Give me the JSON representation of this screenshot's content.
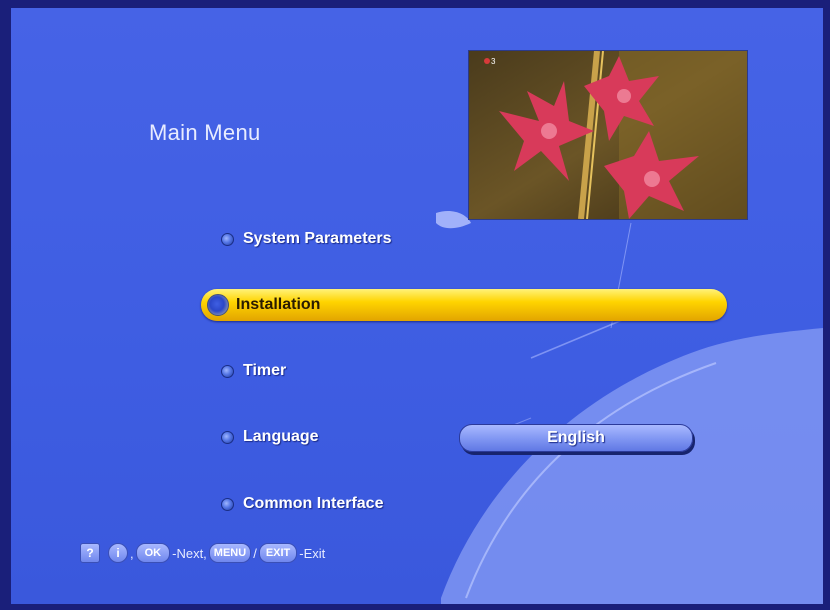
{
  "menu": {
    "title": "Main Menu",
    "items": [
      {
        "label": "System Parameters"
      },
      {
        "label": "Installation",
        "selected": true
      },
      {
        "label": "Timer"
      },
      {
        "label": "Language",
        "value": "English"
      },
      {
        "label": "Common Interface"
      }
    ]
  },
  "footer": {
    "help_icon": "question-mark-icon",
    "info_icon": "info-icon",
    "comma1": ",",
    "ok_key": "OK",
    "next_text": "-Next,",
    "menu_key": "MENU",
    "slash": "/",
    "exit_key": "EXIT",
    "exit_text": "-Exit"
  },
  "preview": {
    "badge": "3"
  },
  "colors": {
    "background": "#3f5fe3",
    "highlight": "#ffd400",
    "text": "#ffffff"
  }
}
